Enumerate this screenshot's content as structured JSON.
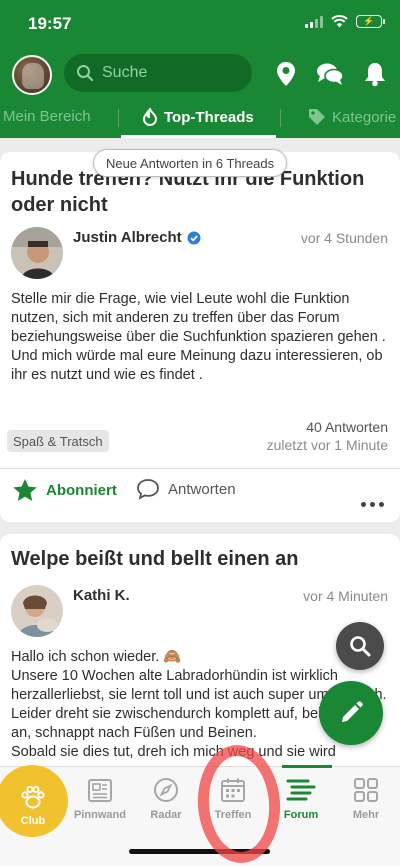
{
  "status": {
    "time": "19:57",
    "battery": "⚡"
  },
  "search": {
    "placeholder": "Suche"
  },
  "tabs": [
    {
      "label": "Mein Bereich"
    },
    {
      "label": "Top-Threads"
    },
    {
      "label": "Kategorie"
    }
  ],
  "notice": "Neue Antworten in 6 Threads",
  "posts": [
    {
      "title": "Hunde treffen? Nutzt ihr die Funktion oder nicht",
      "author": "Justin Albrecht",
      "time": "vor 4 Stunden",
      "body": "Stelle mir die Frage, wie viel Leute wohl die Funktion nutzen, sich mit anderen zu treffen über das Forum beziehungsweise über die Suchfunktion spazieren gehen .\nUnd mich würde mal eure Meinung dazu interessieren, ob ihr es nutzt und wie es findet .",
      "replies": "40 Antworten",
      "last": "zuletzt vor 1 Minute",
      "tag": "Spaß & Tratsch",
      "action_subscribed": "Abonniert",
      "action_reply": "Antworten"
    },
    {
      "title": "Welpe beißt und bellt einen an",
      "author": "Kathi K.",
      "time": "vor 4 Minuten",
      "body": "Hallo ich schon wieder. 🙈\nUnsere 10 Wochen alte Labradorhündin ist wirklich herzallerliebst, sie lernt toll und ist auch super umgänglich.\nLeider dreht sie zwischendurch komplett auf, beißt einen an, schnappt nach Füßen und Beinen.\nSobald sie dies tut, dreh ich mich weg und sie wird"
    }
  ],
  "nav": [
    {
      "label": "Club"
    },
    {
      "label": "Pinnwand"
    },
    {
      "label": "Radar"
    },
    {
      "label": "Treffen"
    },
    {
      "label": "Forum"
    },
    {
      "label": "Mehr"
    }
  ],
  "colors": {
    "brand": "#198734",
    "club": "#f2c12e",
    "annotation": "#f04646"
  }
}
